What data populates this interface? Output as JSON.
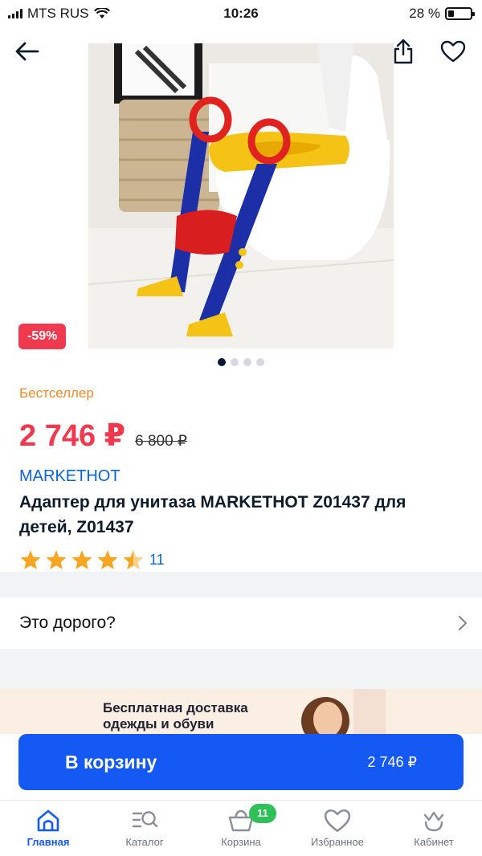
{
  "status_bar": {
    "carrier": "MTS RUS",
    "time": "10:26",
    "battery": "28 %",
    "battery_level": 0.28
  },
  "header": {
    "back_icon": "arrow-left-icon",
    "share_icon": "share-icon",
    "favorite_icon": "heart-icon"
  },
  "product": {
    "discount": "-59%",
    "image_count": 4,
    "active_image_index": 0,
    "bestseller_label": "Бестселлер",
    "price": "2 746 ₽",
    "old_price": "6 800 ₽",
    "brand": "MARKETHOT",
    "title": "Адаптер для унитаза MARKETHOT Z01437 для детей, Z01437",
    "rating": 4.5,
    "rating_count": "11"
  },
  "expensive_row": {
    "label": "Это дорого?"
  },
  "promo": {
    "text_line1": "Бесплатная доставка",
    "text_line2": "одежды и обуви"
  },
  "cart_button": {
    "label": "В корзину",
    "price": "2 746 ₽"
  },
  "tab_bar": {
    "items": [
      {
        "label": "Главная",
        "icon": "home-icon"
      },
      {
        "label": "Каталог",
        "icon": "catalog-search-icon"
      },
      {
        "label": "Корзина",
        "icon": "basket-icon"
      },
      {
        "label": "Избранное",
        "icon": "heart-icon"
      },
      {
        "label": "Кабинет",
        "icon": "crown-icon"
      }
    ],
    "cart_badge": "11"
  },
  "colors": {
    "accent": "#1559f5",
    "price_red": "#f0384f",
    "bestseller_orange": "#f58a2a",
    "brand_blue": "#0a64d8",
    "badge_green": "#2fc05a",
    "star": "#f6a623"
  }
}
